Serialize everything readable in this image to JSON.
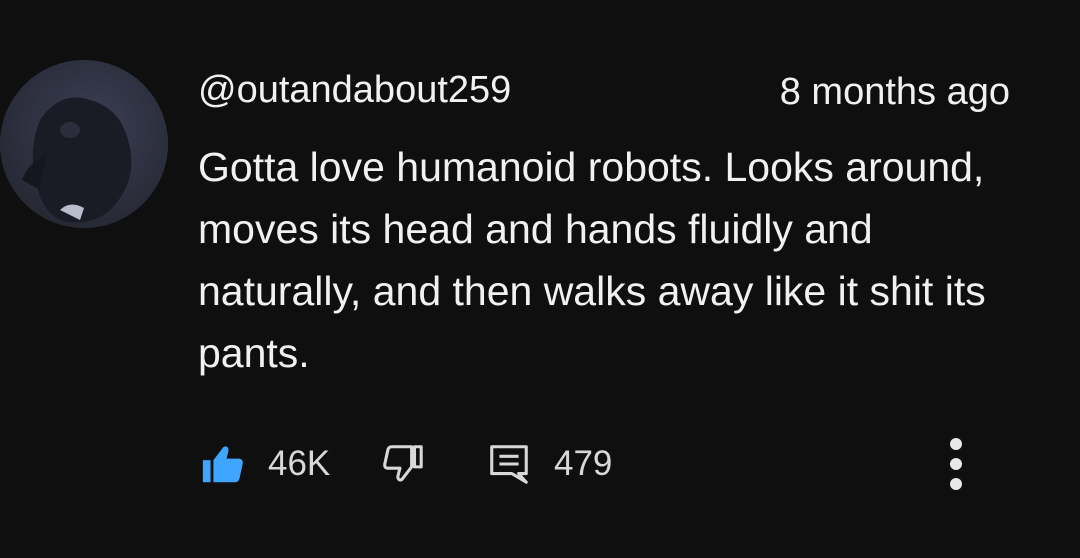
{
  "comment": {
    "username": "@outandabout259",
    "timestamp": "8 months ago",
    "text": "Gotta love humanoid robots. Looks around, moves its head and hands fluidly and naturally, and then walks away like it shit its pants.",
    "like_count": "46K",
    "reply_count": "479"
  },
  "icons": {
    "like": "thumbs-up-icon (filled, liked)",
    "dislike": "thumbs-down-icon",
    "reply": "comment-icon",
    "more": "vertical-dots-icon"
  },
  "colors": {
    "background": "#0f0f0f",
    "text": "#f1f1f1",
    "like_active": "#3ea6ff"
  }
}
